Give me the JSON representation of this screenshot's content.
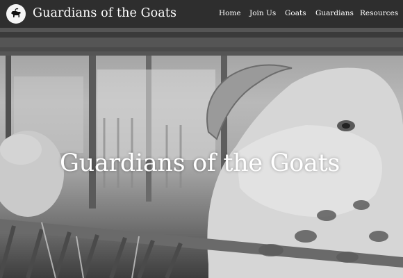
{
  "header": {
    "logo_icon": "goat-icon",
    "brand": "Guardians of the Goats"
  },
  "nav": {
    "items": [
      {
        "label": "Home"
      },
      {
        "label": "Join Us"
      },
      {
        "label": "Goats"
      },
      {
        "label": "Guardians"
      },
      {
        "label": "Resources"
      }
    ]
  },
  "hero": {
    "title": "Guardians of the Goats",
    "image_icon": "goat-photo-background"
  }
}
